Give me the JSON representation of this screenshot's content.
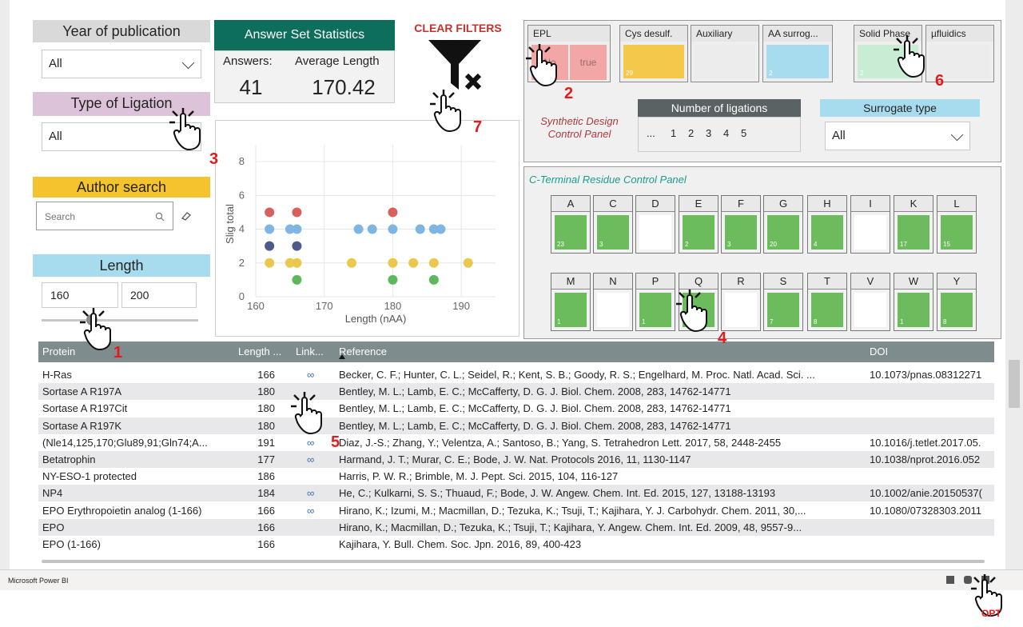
{
  "filters": {
    "year": {
      "title": "Year of publication",
      "value": "All"
    },
    "ligation": {
      "title": "Type of Ligation",
      "value": "All"
    },
    "author": {
      "title": "Author search",
      "placeholder": "Search"
    },
    "length": {
      "title": "Length",
      "min": "160",
      "max": "200"
    }
  },
  "stats": {
    "title": "Answer Set Statistics",
    "answers_label": "Answers:",
    "answers_value": "41",
    "avg_label": "Average Length",
    "avg_value": "170.42"
  },
  "clear_filters": "CLEAR FILTERS",
  "synthetic": {
    "tiles": [
      {
        "label": "EPL",
        "no": "No",
        "true": "true"
      },
      {
        "label": "Cys desulf.",
        "count": "29"
      },
      {
        "label": "Auxiliary"
      },
      {
        "label": "AA surrog...",
        "count": "2"
      },
      {
        "label": "Solid Phase",
        "count": "2"
      },
      {
        "label": "µfluidics"
      }
    ],
    "caption_line1": "Synthetic Design",
    "caption_line2": "Control Panel",
    "num_ligations": {
      "title": "Number of ligations",
      "options": [
        "...",
        "1",
        "2",
        "3",
        "4",
        "5"
      ]
    },
    "surrogate": {
      "title": "Surrogate type",
      "value": "All"
    }
  },
  "cterm": {
    "title": "C-Terminal Residue Control Panel",
    "row1": [
      {
        "l": "A",
        "c": "23"
      },
      {
        "l": "C",
        "c": "3"
      },
      {
        "l": "D",
        "c": ""
      },
      {
        "l": "E",
        "c": "2"
      },
      {
        "l": "F",
        "c": "3"
      },
      {
        "l": "G",
        "c": "20"
      },
      {
        "l": "H",
        "c": "4"
      },
      {
        "l": "I",
        "c": ""
      },
      {
        "l": "K",
        "c": "17"
      },
      {
        "l": "L",
        "c": "15"
      }
    ],
    "row2": [
      {
        "l": "M",
        "c": "1"
      },
      {
        "l": "N",
        "c": ""
      },
      {
        "l": "P",
        "c": "1"
      },
      {
        "l": "Q",
        "c": "2"
      },
      {
        "l": "R",
        "c": ""
      },
      {
        "l": "S",
        "c": "7"
      },
      {
        "l": "T",
        "c": "8"
      },
      {
        "l": "V",
        "c": ""
      },
      {
        "l": "W",
        "c": "1"
      },
      {
        "l": "Y",
        "c": "8"
      }
    ]
  },
  "chart_data": {
    "type": "scatter",
    "xlabel": "Length (nAA)",
    "ylabel": "Slig total",
    "xlim": [
      160,
      195
    ],
    "ylim": [
      0,
      9
    ],
    "xticks": [
      160,
      170,
      180,
      190
    ],
    "yticks": [
      0,
      2,
      4,
      6,
      8
    ],
    "points": [
      {
        "x": 162,
        "y": 5,
        "c": "#d9605c"
      },
      {
        "x": 166,
        "y": 5,
        "c": "#d9605c"
      },
      {
        "x": 180,
        "y": 5,
        "c": "#d9605c"
      },
      {
        "x": 162,
        "y": 4,
        "c": "#7fb5e3"
      },
      {
        "x": 165,
        "y": 4,
        "c": "#7fb5e3"
      },
      {
        "x": 166,
        "y": 4,
        "c": "#7fb5e3"
      },
      {
        "x": 175,
        "y": 4,
        "c": "#7fb5e3"
      },
      {
        "x": 177,
        "y": 4,
        "c": "#7fb5e3"
      },
      {
        "x": 180,
        "y": 4,
        "c": "#7fb5e3"
      },
      {
        "x": 184,
        "y": 4,
        "c": "#7fb5e3"
      },
      {
        "x": 186,
        "y": 4,
        "c": "#7fb5e3"
      },
      {
        "x": 187,
        "y": 4,
        "c": "#7fb5e3"
      },
      {
        "x": 162,
        "y": 3,
        "c": "#4d5a8c"
      },
      {
        "x": 166,
        "y": 3,
        "c": "#4d5a8c"
      },
      {
        "x": 162,
        "y": 2,
        "c": "#eac84e"
      },
      {
        "x": 165,
        "y": 2,
        "c": "#eac84e"
      },
      {
        "x": 166,
        "y": 2,
        "c": "#eac84e"
      },
      {
        "x": 174,
        "y": 2,
        "c": "#eac84e"
      },
      {
        "x": 180,
        "y": 2,
        "c": "#eac84e"
      },
      {
        "x": 183,
        "y": 2,
        "c": "#eac84e"
      },
      {
        "x": 186,
        "y": 2,
        "c": "#eac84e"
      },
      {
        "x": 191,
        "y": 2,
        "c": "#eac84e"
      },
      {
        "x": 166,
        "y": 1,
        "c": "#5db85c"
      },
      {
        "x": 180,
        "y": 1,
        "c": "#5db85c"
      },
      {
        "x": 186,
        "y": 1,
        "c": "#5db85c"
      }
    ]
  },
  "table": {
    "columns": [
      "Protein",
      "Length ...",
      "Link...",
      "Reference",
      "DOI"
    ],
    "rows": [
      {
        "protein": "H-Ras",
        "length": "166",
        "link": true,
        "ref": "Becker, C. F.; Hunter, C. L.; Seidel, R.; Kent, S. B.; Goody, R. S.; Engelhard, M. Proc. Natl. Acad. Sci. ...",
        "doi": "10.1073/pnas.08312271"
      },
      {
        "protein": "Sortase A R197A",
        "length": "180",
        "link": false,
        "ref": "Bentley, M. L.; Lamb, E. C.; McCafferty, D. G. J. Biol. Chem. 2008, 283, 14762-14771",
        "doi": ""
      },
      {
        "protein": "Sortase A R197Cit",
        "length": "180",
        "link": false,
        "ref": "Bentley, M. L.; Lamb, E. C.; McCafferty, D. G. J. Biol. Chem. 2008, 283, 14762-14771",
        "doi": ""
      },
      {
        "protein": "Sortase A R197K",
        "length": "180",
        "link": false,
        "ref": "Bentley, M. L.; Lamb, E. C.; McCafferty, D. G. J. Biol. Chem. 2008, 283, 14762-14771",
        "doi": ""
      },
      {
        "protein": "(Nle14,125,170;Glu89,91;Gln74;A...",
        "length": "191",
        "link": true,
        "ref": "Diaz, J.-S.; Zhang, Y.; Velentza, A.; Santoso, B.; Yang, S. Tetrahedron Lett. 2017, 58, 2448-2455",
        "doi": "10.1016/j.tetlet.2017.05."
      },
      {
        "protein": "Betatrophin",
        "length": "177",
        "link": true,
        "ref": "Harmand, J. T.; Murar, C. E.; Bode, J. W. Nat. Protocols 2016, 11, 1130-1147",
        "doi": "10.1038/nprot.2016.052"
      },
      {
        "protein": "NY-ESO-1 protected",
        "length": "186",
        "link": false,
        "ref": "Harris, P. W. R.; Brimble, M. J. Pept. Sci. 2015, 104, 116-127",
        "doi": ""
      },
      {
        "protein": "NP4",
        "length": "184",
        "link": true,
        "ref": "He, C.; Kulkarni, S. S.; Thuaud, F.; Bode, J. W. Angew. Chem. Int. Ed. 2015, 127, 13188-13193",
        "doi": "10.1002/anie.20150537("
      },
      {
        "protein": "EPO Erythropoietin analog (1-166)",
        "length": "166",
        "link": true,
        "ref": "Hirano, K.; Izumi, M.; Macmillan, D.; Tezuka, K.; Tsuji, T.; Kajihara, Y. J. Carbohydr. Chem. 2011, 30,...",
        "doi": "10.1080/07328303.2011"
      },
      {
        "protein": "EPO",
        "length": "166",
        "link": false,
        "ref": "Hirano, K.; Macmillan, D.; Tezuka, K.; Tsuji, T.; Kajihara, Y. Angew. Chem. Int. Ed. 2009, 48, 9557-9...",
        "doi": ""
      },
      {
        "protein": "EPO (1-166)",
        "length": "166",
        "link": false,
        "ref": "Kajihara, Y. Bull. Chem. Soc. Jpn. 2016, 89, 400-423",
        "doi": ""
      }
    ]
  },
  "footer": {
    "brand": "Microsoft Power BI"
  },
  "markers": [
    "1",
    "2",
    "3",
    "4",
    "5",
    "6",
    "7",
    "OPT"
  ],
  "colors": {
    "stats_header": "#0e6e5c",
    "slicer_year": "#d9d9d9",
    "slicer_ligation": "#dcc3d9",
    "slicer_author": "#f4c32e",
    "slicer_length": "#a7dcef",
    "clear_red": "#c8302c",
    "green_tile": "#6cbb5c"
  }
}
